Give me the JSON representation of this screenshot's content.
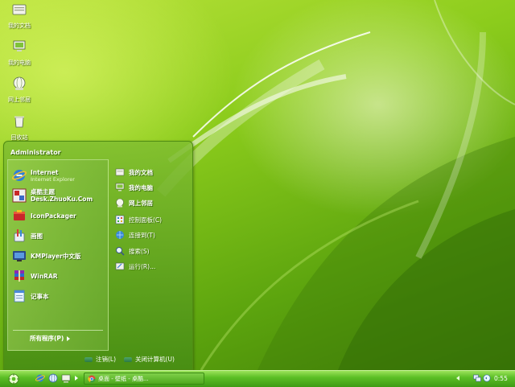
{
  "desktop": {
    "icons": [
      {
        "label": "我的文档",
        "icon": "folder-documents-icon"
      },
      {
        "label": "我的电脑",
        "icon": "computer-icon"
      },
      {
        "label": "网上邻居",
        "icon": "network-icon"
      },
      {
        "label": "回收站",
        "icon": "recycle-bin-icon"
      }
    ]
  },
  "start_menu": {
    "user": "Administrator",
    "programs": [
      {
        "title": "Internet",
        "subtitle": "Internet Explorer",
        "icon": "internet-explorer-icon"
      },
      {
        "title": "桌酷主题",
        "subtitle": "Desk.ZhuoKu.Com",
        "icon": "zhuoku-theme-icon"
      },
      {
        "title": "IconPackager",
        "subtitle": "",
        "icon": "iconpackager-icon"
      },
      {
        "title": "画图",
        "subtitle": "",
        "icon": "paint-icon"
      },
      {
        "title": "KMPlayer中文版",
        "subtitle": "",
        "icon": "kmplayer-icon"
      },
      {
        "title": "WinRAR",
        "subtitle": "",
        "icon": "winrar-icon"
      },
      {
        "title": "记事本",
        "subtitle": "",
        "icon": "notepad-icon"
      }
    ],
    "all_programs": "所有程序(P)",
    "places": [
      {
        "label": "我的文档",
        "icon": "folder-documents-icon"
      },
      {
        "label": "我的电脑",
        "icon": "computer-icon"
      },
      {
        "label": "网上邻居",
        "icon": "network-icon"
      },
      {
        "label": "控制面板(C)",
        "icon": "control-panel-icon"
      },
      {
        "label": "连接到(T)",
        "icon": "connect-to-icon"
      },
      {
        "label": "搜索(S)",
        "icon": "search-icon"
      },
      {
        "label": "运行(R)...",
        "icon": "run-icon"
      }
    ],
    "logoff": "注销(L)",
    "shutdown": "关闭计算机(U)"
  },
  "taskbar": {
    "task_label": "桌面 - 壁纸 - 桌酷...",
    "clock": "0:55"
  },
  "colors": {
    "accent": "#5cbf26",
    "menu": "#76b42c"
  }
}
